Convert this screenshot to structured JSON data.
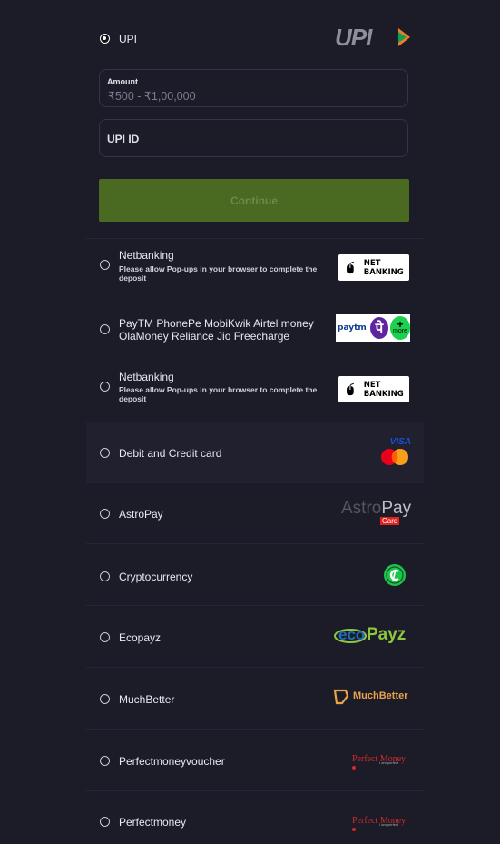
{
  "upi": {
    "label": "UPI",
    "logo_text": "UPI",
    "amount_label": "Amount",
    "amount_placeholder": "₹500 - ₹1,00,000",
    "upi_id_placeholder": "UPI ID",
    "continue_label": "Continue"
  },
  "methods": [
    {
      "label": "Netbanking",
      "note": "Please allow Pop-ups in your browser to complete the deposit",
      "logo": "NET BANKING"
    },
    {
      "label": "PayTM PhonePe MobiKwik Airtel money",
      "label2": "OlaMoney Reliance Jio Freecharge",
      "logo_paytm": "paytm",
      "logo_phonepe": "पे",
      "logo_more": "more"
    },
    {
      "label": "Netbanking",
      "note": "Please allow Pop-ups in your browser to complete the deposit",
      "logo": "NET BANKING"
    },
    {
      "label": "Debit and Credit card",
      "logo": "VISA"
    },
    {
      "label": "AstroPay",
      "logo_a": "Astro",
      "logo_b": "Pay",
      "logo_c": "Card"
    },
    {
      "label": "Cryptocurrency"
    },
    {
      "label": "Ecopayz",
      "logo_a": "eco",
      "logo_b": "Payz"
    },
    {
      "label": "MuchBetter",
      "logo": "MuchBetter"
    },
    {
      "label": "Perfectmoneyvoucher",
      "logo": "Perfect Money",
      "logo_sub": "I am perfect"
    },
    {
      "label": "Perfectmoney",
      "logo": "Perfect Money",
      "logo_sub": "I am perfect"
    }
  ],
  "colors": {
    "background": "#1c1c29",
    "continue_bg": "#4a6a21",
    "upi_orange": "#f47c20",
    "upi_green": "#0f9d58"
  }
}
